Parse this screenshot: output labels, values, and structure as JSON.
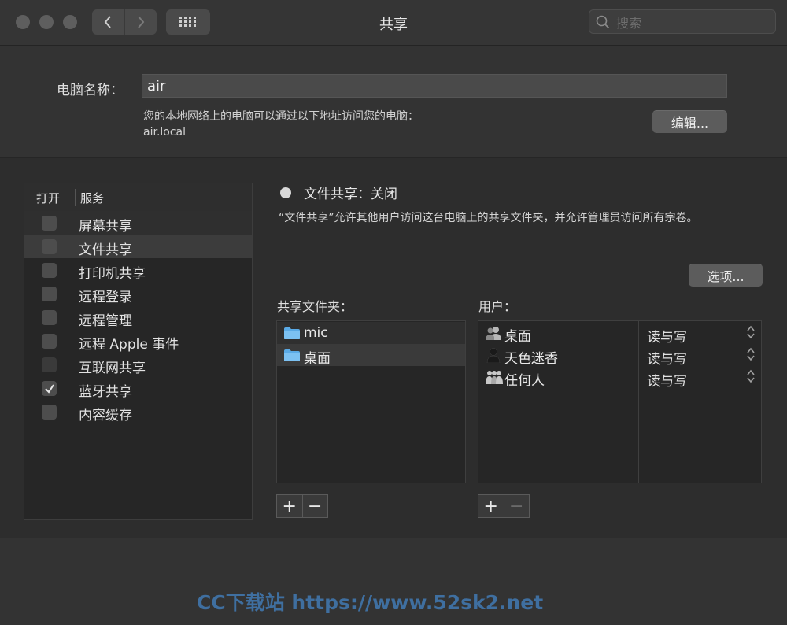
{
  "window": {
    "title": "共享"
  },
  "search": {
    "placeholder": "搜索"
  },
  "computer_name": {
    "label": "电脑名称：",
    "value": "air",
    "desc_line1": "您的本地网络上的电脑可以通过以下地址访问您的电脑：",
    "desc_line2": "air.local",
    "edit_label": "编辑..."
  },
  "services": {
    "col_on": "打开",
    "col_service": "服务",
    "items": [
      {
        "label": "屏幕共享",
        "checked": false
      },
      {
        "label": "文件共享",
        "checked": false,
        "selected": true
      },
      {
        "label": "打印机共享",
        "checked": false
      },
      {
        "label": "远程登录",
        "checked": false
      },
      {
        "label": "远程管理",
        "checked": false
      },
      {
        "label": "远程 Apple 事件",
        "checked": false
      },
      {
        "label": "互联网共享",
        "checked": false,
        "disabled": true
      },
      {
        "label": "蓝牙共享",
        "checked": true
      },
      {
        "label": "内容缓存",
        "checked": false
      }
    ]
  },
  "detail": {
    "status": "文件共享：关闭",
    "description": "“文件共享”允许其他用户访问这台电脑上的共享文件夹，并允许管理员访问所有宗卷。",
    "options_label": "选项...",
    "shared_folders_label": "共享文件夹：",
    "users_label": "用户：",
    "folders": [
      {
        "name": "mic",
        "icon": "folder-icon"
      },
      {
        "name": "桌面",
        "icon": "folder-icon"
      }
    ],
    "users": [
      {
        "name": "桌面",
        "icon": "group-icon",
        "permission": "读与写"
      },
      {
        "name": "天色迷香",
        "icon": "user-icon",
        "permission": "读与写"
      },
      {
        "name": "任何人",
        "icon": "everyone-icon",
        "permission": "读与写"
      }
    ],
    "add_symbol": "+",
    "remove_symbol": "−"
  },
  "watermark": "CC下载站  https://www.52sk2.net"
}
